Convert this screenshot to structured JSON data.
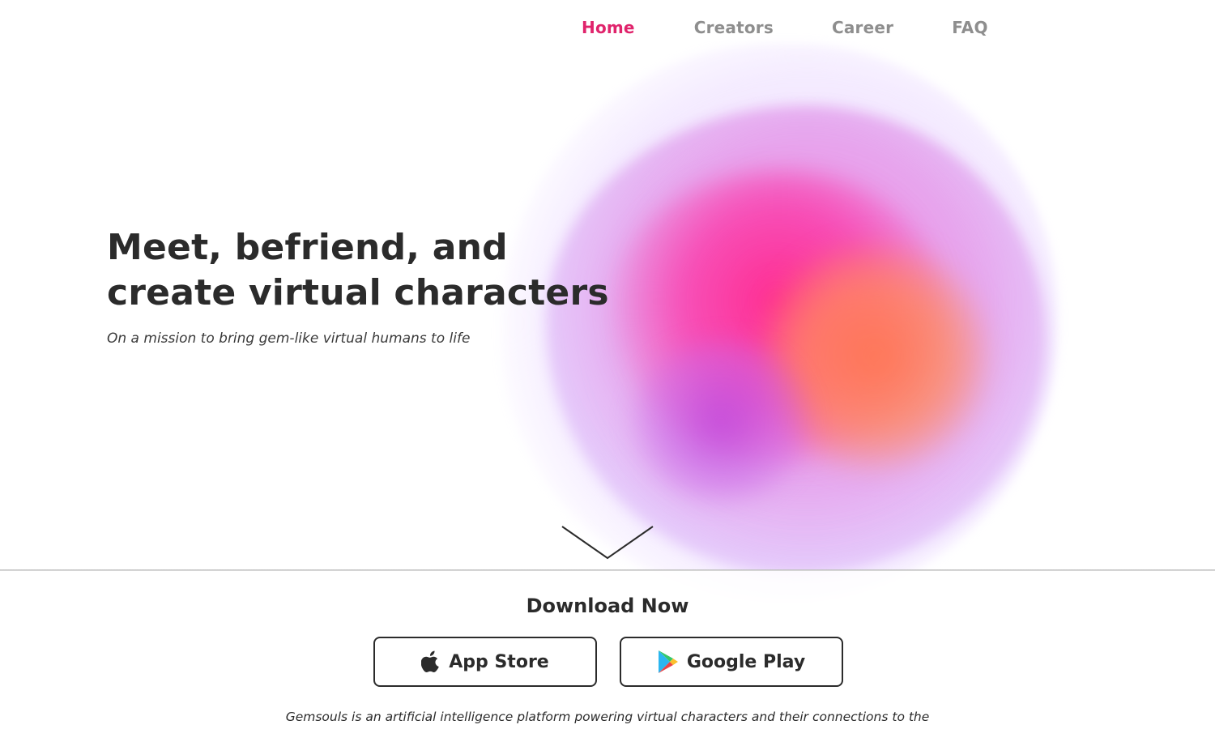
{
  "nav": {
    "items": [
      {
        "label": "Home",
        "active": true
      },
      {
        "label": "Creators",
        "active": false
      },
      {
        "label": "Career",
        "active": false
      },
      {
        "label": "FAQ",
        "active": false
      }
    ]
  },
  "hero": {
    "title_line1": "Meet, befriend, and",
    "title_line2": "create virtual characters",
    "tagline": "On a mission to bring gem-like virtual humans to life"
  },
  "download": {
    "title": "Download Now",
    "app_store_label": "App Store",
    "google_play_label": "Google Play"
  },
  "about": {
    "text": "Gemsouls is an artificial intelligence platform powering virtual characters and their connections to the"
  },
  "icons": {
    "scroll_down": "chevron-down-icon",
    "app_store": "apple-icon",
    "google_play": "google-play-icon"
  },
  "colors": {
    "accent": "#e0246c",
    "nav_inactive": "#8e8e8e",
    "text": "#2b2b2b"
  }
}
